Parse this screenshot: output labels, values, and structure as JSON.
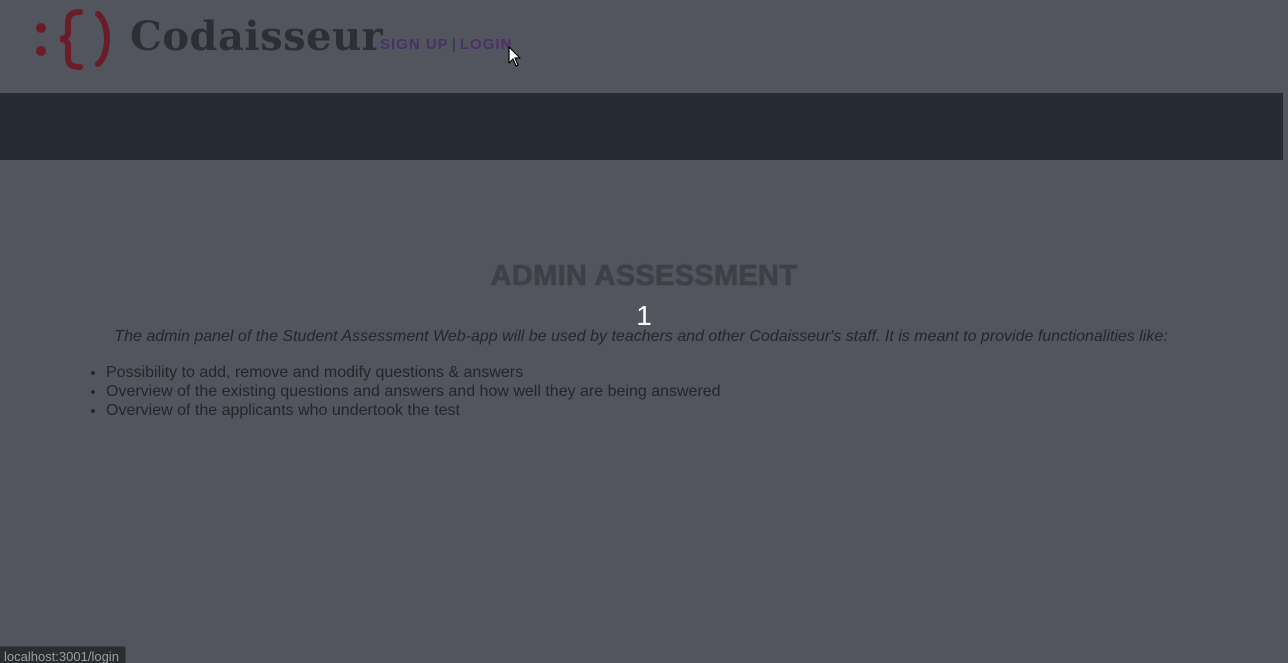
{
  "header": {
    "logo_text": "Codaisseur",
    "signup_label": "SIGN UP",
    "separator": "|",
    "login_label": "LOGIN"
  },
  "main": {
    "title": "ADMIN ASSESSMENT",
    "number": "1",
    "description": "The admin panel of the Student Assessment Web-app will be used by teachers and other Codaisseur's staff. It is meant to provide functionalities like:",
    "features": [
      "Possibility to add, remove and modify questions & answers",
      "Overview of the existing questions and answers and how well they are being answered",
      "Overview of the applicants who undertook the test"
    ]
  },
  "status_bar": {
    "url": "localhost:3001/login"
  },
  "colors": {
    "background": "#52555d",
    "navbar": "#262a33",
    "logo_accent": "#6b1c2a",
    "link": "#4c2f6a"
  },
  "icons": {
    "logo": "codaisseur-logo-icon",
    "cursor": "mouse-pointer-icon"
  }
}
